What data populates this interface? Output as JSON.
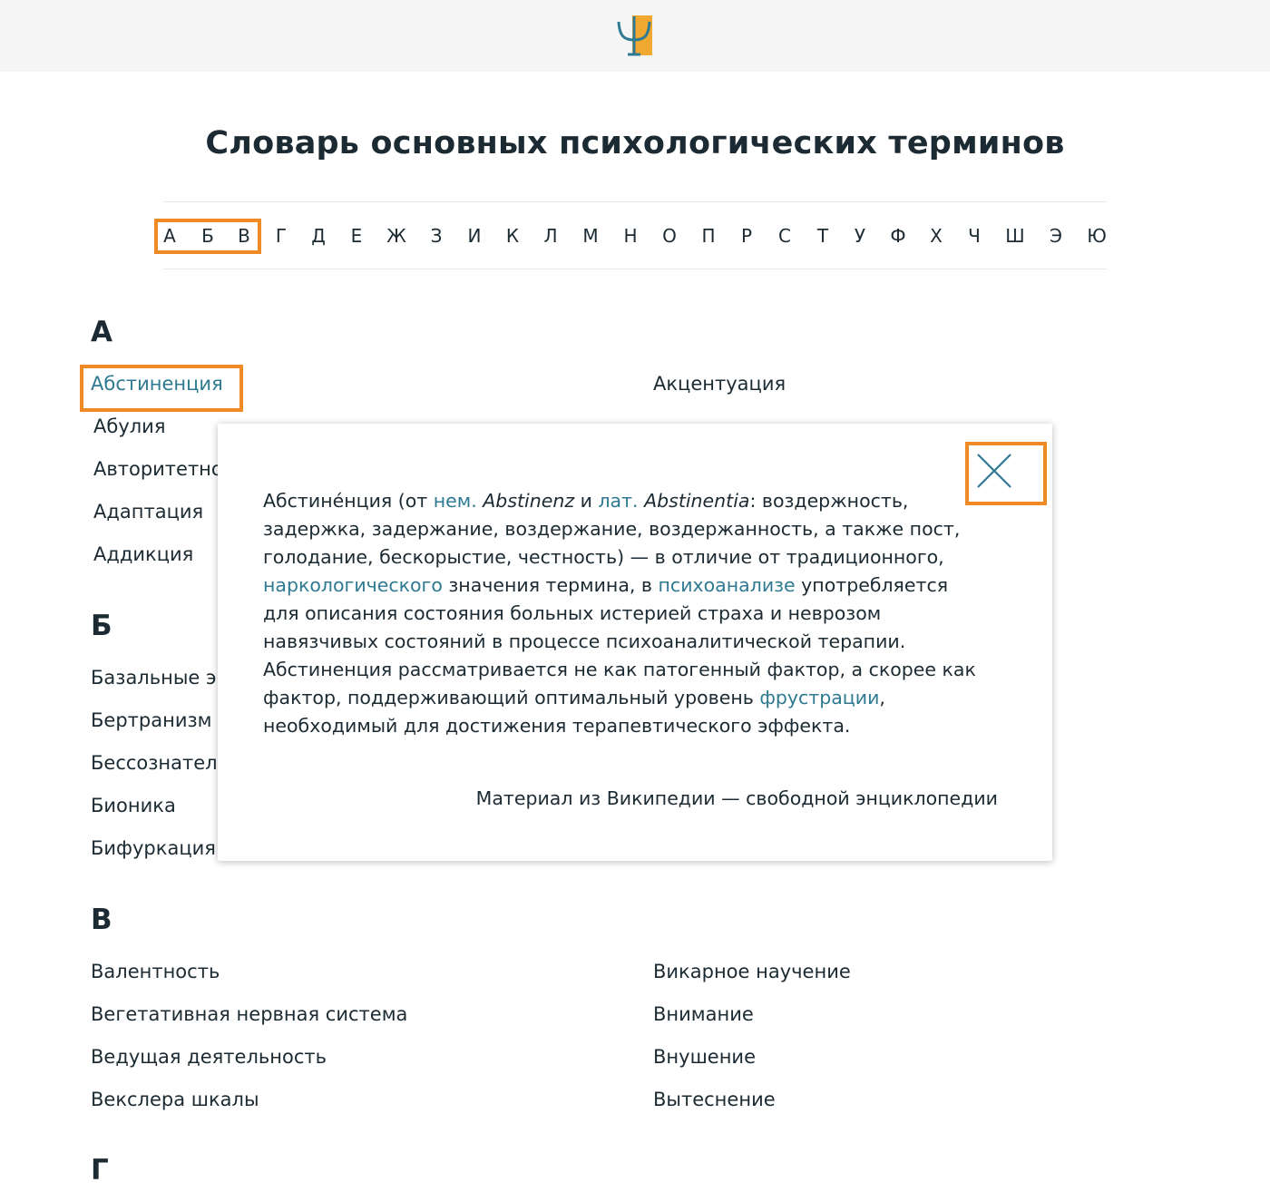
{
  "header": {
    "logo_icon": "psi-logo-icon"
  },
  "page_title": "Словарь основных психологических терминов",
  "alphabet": [
    "А",
    "Б",
    "В",
    "Г",
    "Д",
    "Е",
    "Ж",
    "З",
    "И",
    "К",
    "Л",
    "М",
    "Н",
    "О",
    "П",
    "Р",
    "С",
    "Т",
    "У",
    "Ф",
    "Х",
    "Ч",
    "Ш",
    "Э",
    "Ю"
  ],
  "sections": [
    {
      "letter": "А",
      "left_terms": [
        "Абстиненция",
        "Абулия",
        "Авторитетно",
        "Адаптация",
        "Аддикция"
      ],
      "right_terms": [
        "Акцентуация"
      ]
    },
    {
      "letter": "Б",
      "left_terms": [
        "Базальные эı",
        "Бертранизм",
        "Бессознател",
        "Бионика",
        "Бифуркация"
      ],
      "right_terms": []
    },
    {
      "letter": "В",
      "left_terms": [
        "Валентность",
        "Вегетативная нервная система",
        "Ведущая деятельность",
        "Векслера шкалы"
      ],
      "right_terms": [
        "Викарное научение",
        "Внимание",
        "Внушение",
        "Вытеснение"
      ]
    },
    {
      "letter": "Г",
      "left_terms": [],
      "right_terms": []
    }
  ],
  "modal": {
    "term": "Абстине́нция",
    "t1": " (от ",
    "link_nem": "нем.",
    "t2": " ",
    "abstinenz": "Abstinenz",
    "t3": " и ",
    "link_lat": "лат.",
    "t4": " ",
    "abstinentia": "Abstinentia",
    "t5": ": воздержность, задержка, задержание, воздержание, воздержанность, а также пост, голодание, бескорыстие, честность) — в отличие от традиционного, ",
    "link_narco": "наркологического",
    "t6": " значения термина, в ",
    "link_psycho": "психоанализе",
    "t7": " употребляется для описания состояния больных истерией страха и неврозом навязчивых состояний в процессе психоаналитической терапии. Абстиненция рассматривается не как патогенный фактор, а скорее как фактор, поддерживающий оптимальный уровень ",
    "link_frustr": "фрустрации",
    "t8": ", необходимый для достижения терапевтического эффекта.",
    "source": "Материал из Википедии — свободной энциклопедии",
    "close_icon": "close-icon"
  },
  "colors": {
    "link": "#2f7a92",
    "highlight": "#f08a24",
    "text": "#1c2b33",
    "header_bg": "#f4f5f4",
    "logo": "#f0a830"
  }
}
